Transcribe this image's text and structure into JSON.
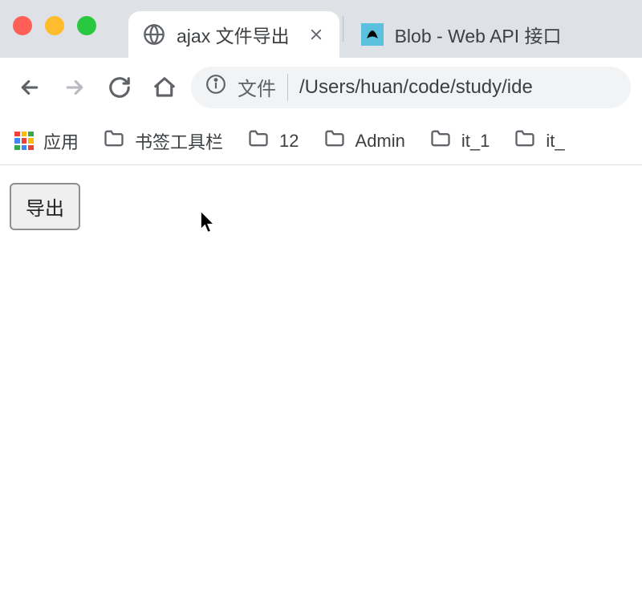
{
  "window": {
    "tabs": [
      {
        "title": "ajax 文件导出",
        "active": true
      },
      {
        "title": "Blob - Web API 接口",
        "active": false
      }
    ]
  },
  "omnibox": {
    "kind_label": "文件",
    "path": "/Users/huan/code/study/ide"
  },
  "bookmarks": {
    "apps_label": "应用",
    "items": [
      {
        "label": "书签工具栏"
      },
      {
        "label": "12"
      },
      {
        "label": "Admin"
      },
      {
        "label": "it_1"
      },
      {
        "label": "it_"
      }
    ]
  },
  "page": {
    "export_button": "导出"
  }
}
